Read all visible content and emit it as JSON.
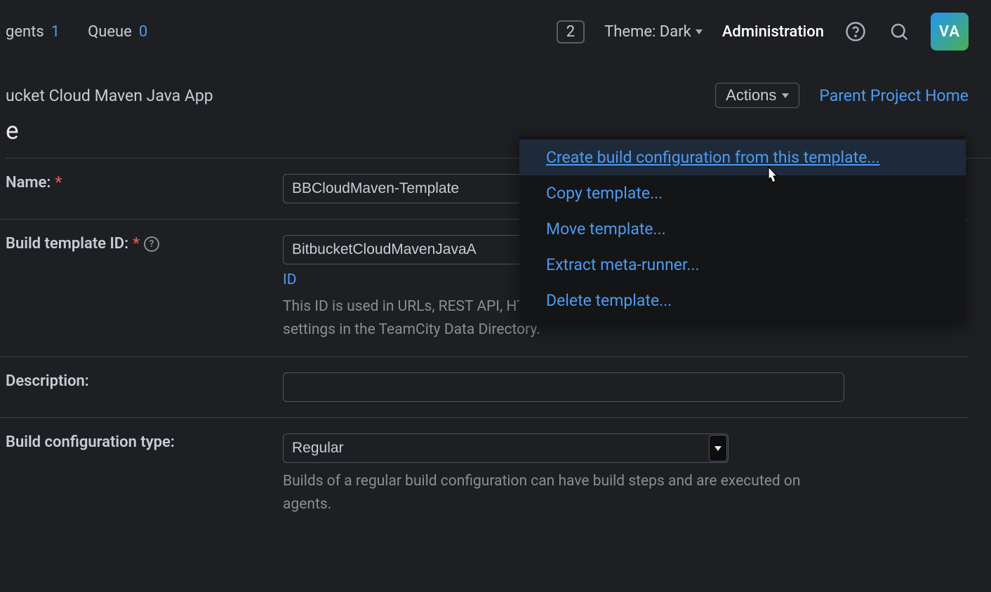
{
  "topbar": {
    "agents_label": "gents",
    "agents_count": "1",
    "queue_label": "Queue",
    "queue_count": "0",
    "badge": "2",
    "theme_label": "Theme: Dark",
    "admin_label": "Administration",
    "avatar_initials": "VA"
  },
  "subheader": {
    "breadcrumb": "ucket Cloud Maven Java App",
    "actions_label": "Actions",
    "parent_link": "Parent Project Home"
  },
  "heading": "e",
  "form": {
    "name_label": "Name:",
    "name_value": "BBCloudMaven-Template",
    "id_label": "Build template ID:",
    "id_value": "BitbucketCloudMavenJavaA",
    "id_link": "ID",
    "id_hint": "This ID is used in URLs, REST API, HTTP requests to the server, and configuration settings in the TeamCity Data Directory.",
    "desc_label": "Description:",
    "desc_value": "",
    "type_label": "Build configuration type:",
    "type_value": "Regular",
    "type_hint": "Builds of a regular build configuration can have build steps and are executed on agents."
  },
  "actions_menu": {
    "create": "Create build configuration from this template...",
    "copy": "Copy template...",
    "move": "Move template...",
    "extract": "Extract meta-runner...",
    "delete": "Delete template..."
  }
}
